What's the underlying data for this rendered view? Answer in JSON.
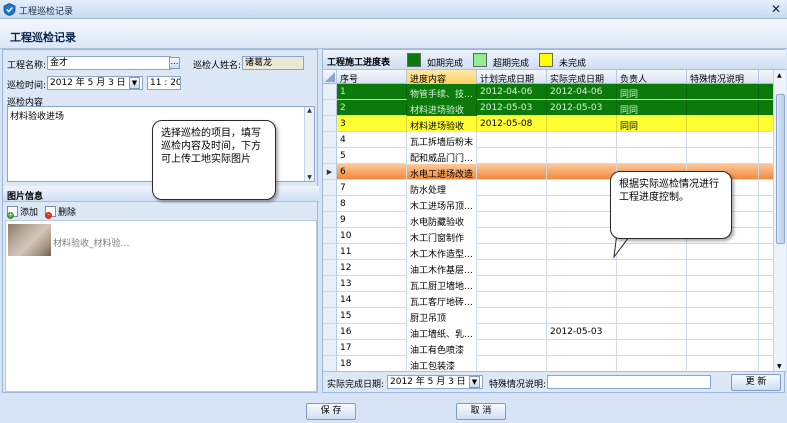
{
  "window": {
    "title": "工程巡检记录",
    "close_glyph": "✕"
  },
  "header": {
    "title": "工程巡检记录"
  },
  "form": {
    "project_label": "工程名称:",
    "project_value": "金才",
    "inspector_label": "巡检人姓名:",
    "inspector_value": "诸葛龙",
    "time_label": "巡检时间:",
    "date_value": "2012 年 5 月 3 日",
    "time_value": "11 : 20",
    "content_label": "巡检内容",
    "content_value": "材料验收进场"
  },
  "pictures": {
    "section_title": "图片信息",
    "add_label": "添加",
    "delete_label": "删除",
    "items": [
      {
        "caption": "材料验收_材料验…"
      }
    ]
  },
  "progress": {
    "section_title": "工程施工进度表",
    "legend": [
      {
        "label": "如期完成",
        "color": "#0b7a0b"
      },
      {
        "label": "超期完成",
        "color": "#90ee90"
      },
      {
        "label": "未完成",
        "color": "#ffff00"
      }
    ],
    "columns": [
      "序号",
      "进度内容",
      "计划完成日期",
      "实际完成日期",
      "负责人",
      "特殊情况说明"
    ],
    "rows": [
      {
        "no": "1",
        "content": "物管手续、技…",
        "planned": "2012-04-06",
        "actual": "2012-04-06",
        "owner": "同同",
        "note": "",
        "status": "green"
      },
      {
        "no": "2",
        "content": "材料进场验收",
        "planned": "2012-05-03",
        "actual": "2012-05-03",
        "owner": "同同",
        "note": "",
        "status": "green"
      },
      {
        "no": "3",
        "content": "材料进场验收",
        "planned": "2012-05-08",
        "actual": "",
        "owner": "同同",
        "note": "",
        "status": "yellow"
      },
      {
        "no": "4",
        "content": "瓦工拆墙后粉末",
        "planned": "",
        "actual": "",
        "owner": "",
        "note": "",
        "status": "none"
      },
      {
        "no": "5",
        "content": "配和威品门门…",
        "planned": "",
        "actual": "",
        "owner": "",
        "note": "",
        "status": "none"
      },
      {
        "no": "6",
        "content": "水电工进场改造",
        "planned": "",
        "actual": "",
        "owner": "",
        "note": "",
        "status": "orange"
      },
      {
        "no": "7",
        "content": "防水处理",
        "planned": "",
        "actual": "",
        "owner": "",
        "note": "",
        "status": "none"
      },
      {
        "no": "8",
        "content": "木工进场吊顶…",
        "planned": "",
        "actual": "",
        "owner": "",
        "note": "",
        "status": "none"
      },
      {
        "no": "9",
        "content": "水电防藏验收",
        "planned": "",
        "actual": "",
        "owner": "",
        "note": "",
        "status": "none"
      },
      {
        "no": "10",
        "content": "木工门窗制作",
        "planned": "",
        "actual": "",
        "owner": "",
        "note": "",
        "status": "none"
      },
      {
        "no": "11",
        "content": "木工木作造型…",
        "planned": "",
        "actual": "",
        "owner": "",
        "note": "",
        "status": "none"
      },
      {
        "no": "12",
        "content": "油工木作基层…",
        "planned": "",
        "actual": "",
        "owner": "",
        "note": "",
        "status": "none"
      },
      {
        "no": "13",
        "content": "瓦工厨卫墙地…",
        "planned": "",
        "actual": "",
        "owner": "",
        "note": "",
        "status": "none"
      },
      {
        "no": "14",
        "content": "瓦工客厅地砖…",
        "planned": "",
        "actual": "",
        "owner": "",
        "note": "",
        "status": "none"
      },
      {
        "no": "15",
        "content": "厨卫吊顶",
        "planned": "",
        "actual": "",
        "owner": "",
        "note": "",
        "status": "none"
      },
      {
        "no": "16",
        "content": "油工墙纸、乳…",
        "planned": "",
        "actual": "2012-05-03",
        "owner": "",
        "note": "",
        "status": "none"
      },
      {
        "no": "17",
        "content": "油工有色喷漆",
        "planned": "",
        "actual": "",
        "owner": "",
        "note": "",
        "status": "none"
      },
      {
        "no": "18",
        "content": "油工包装漆",
        "planned": "",
        "actual": "",
        "owner": "",
        "note": "",
        "status": "none"
      }
    ],
    "current_row_marker": "▶",
    "actual_date_label": "实际完成日期:",
    "actual_date_value": "2012 年 5 月 3 日",
    "note_label": "特殊情况说明:",
    "note_value": "",
    "update_label": "更 新"
  },
  "callouts": {
    "left": "选择巡检的项目，填写巡检内容及时间，下方可上传工地实际图片",
    "right": "根据实际巡检情况进行工程进度控制。"
  },
  "buttons": {
    "save": "保 存",
    "cancel": "取 消"
  }
}
